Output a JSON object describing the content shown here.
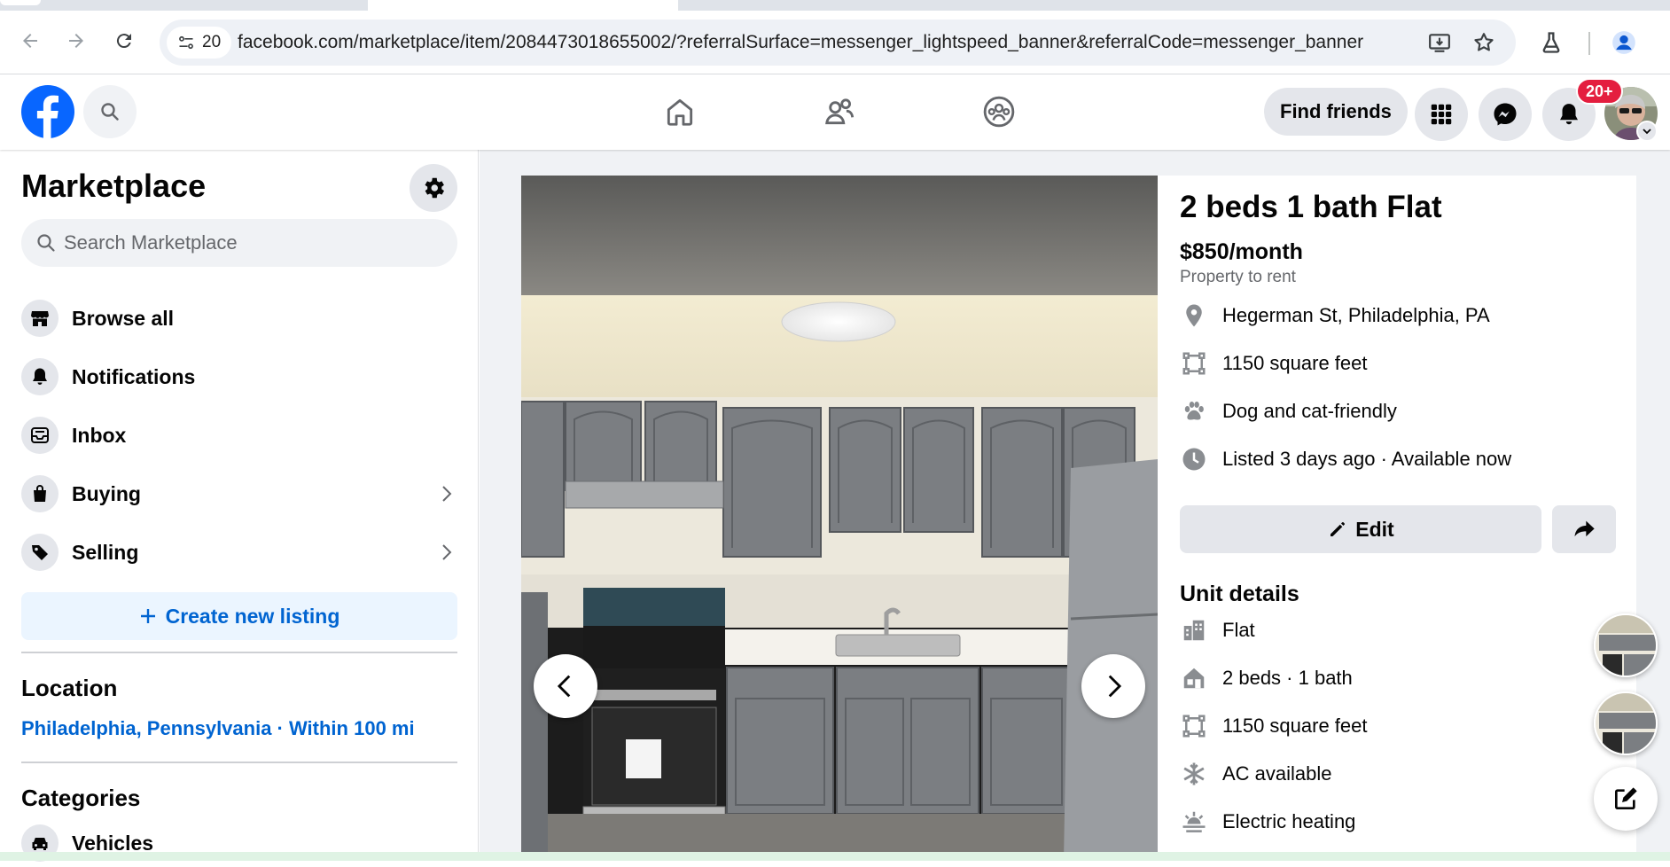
{
  "browser": {
    "site_info_count": "20",
    "url": "facebook.com/marketplace/item/2084473018655002/?referralSurface=messenger_lightspeed_banner&referralCode=messenger_banner",
    "icons": [
      "back-icon",
      "forward-icon",
      "reload-icon",
      "site-settings-icon",
      "install-app-icon",
      "bookmark-star-icon",
      "labs-flask-icon",
      "profile-icon"
    ]
  },
  "fb_header": {
    "find_friends_label": "Find friends",
    "notification_badge": "20+",
    "brand_color": "#0866ff",
    "icons": [
      "facebook-logo-icon",
      "search-icon",
      "home-icon",
      "friends-icon",
      "groups-icon",
      "menu-grid-icon",
      "messenger-icon",
      "bell-icon"
    ]
  },
  "sidebar": {
    "title": "Marketplace",
    "search_placeholder": "Search Marketplace",
    "items": [
      {
        "label": "Browse all",
        "icon": "storefront-icon"
      },
      {
        "label": "Notifications",
        "icon": "bell-icon"
      },
      {
        "label": "Inbox",
        "icon": "inbox-icon"
      },
      {
        "label": "Buying",
        "icon": "shopping-bag-icon"
      },
      {
        "label": "Selling",
        "icon": "price-tag-icon"
      }
    ],
    "create_label": "Create new listing",
    "location_heading": "Location",
    "location_value": "Philadelphia, Pennsylvania · Within 100 mi",
    "categories_heading": "Categories",
    "first_category": "Vehicles",
    "link_color": "#0064d1"
  },
  "listing": {
    "title": "2 beds 1 bath Flat",
    "price": "$850/month",
    "type": "Property to rent",
    "facts": [
      {
        "text": "Hegerman St, Philadelphia, PA",
        "icon": "location-pin-icon"
      },
      {
        "text": "1150 square feet",
        "icon": "area-frame-icon"
      },
      {
        "text": "Dog and cat-friendly",
        "icon": "paw-icon"
      },
      {
        "text": "Listed 3 days ago · Available now",
        "icon": "clock-icon"
      }
    ],
    "edit_label": "Edit",
    "unit_details_heading": "Unit details",
    "unit_details": [
      {
        "text": "Flat",
        "icon": "building-icon"
      },
      {
        "text": "2 beds · 1 bath",
        "icon": "house-icon"
      },
      {
        "text": "1150 square feet",
        "icon": "area-frame-icon"
      },
      {
        "text": "AC available",
        "icon": "snowflake-icon"
      },
      {
        "text": "Electric heating",
        "icon": "heating-icon"
      }
    ]
  }
}
